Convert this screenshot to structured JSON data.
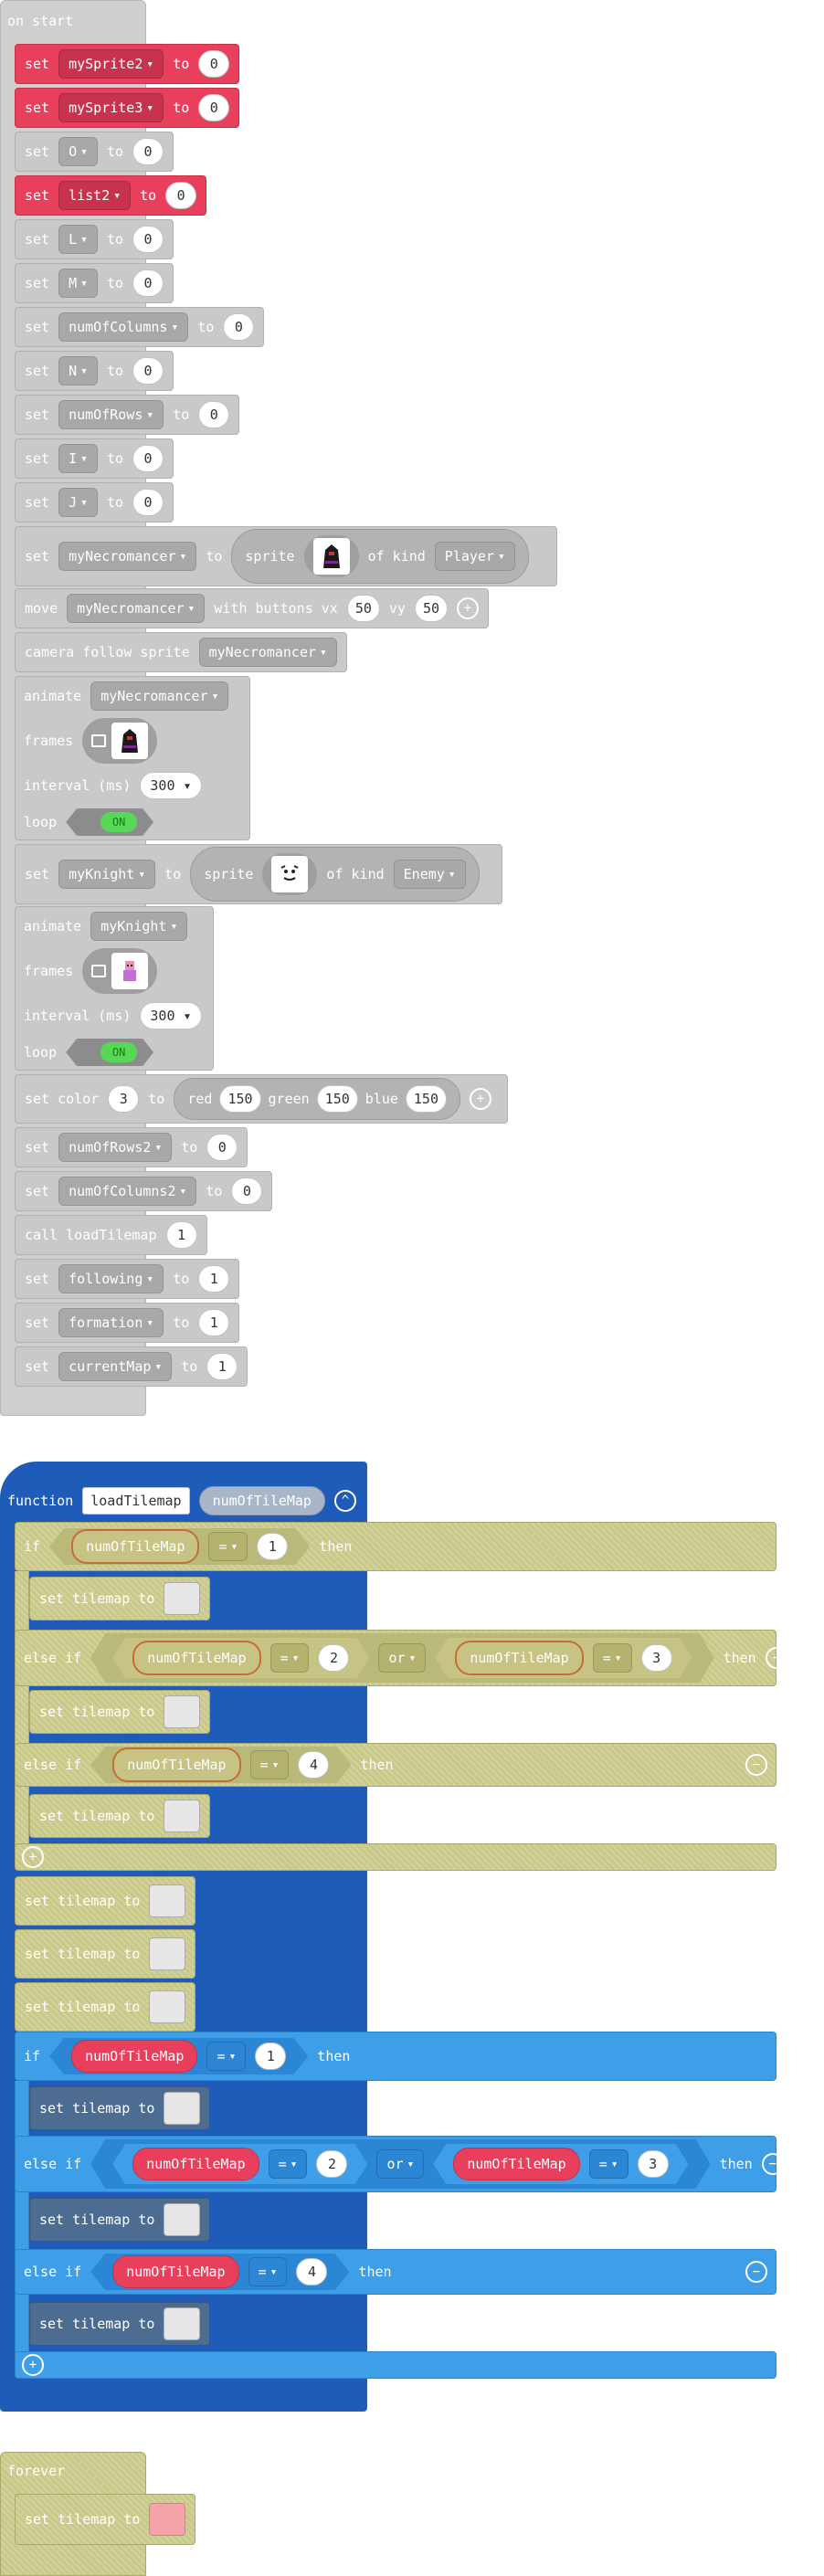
{
  "colors": {
    "gray": "#cfcfcf",
    "red": "#e8405c",
    "olive": "#c8c888",
    "blue": "#3e9fe8",
    "dark_blue": "#1f5bb8",
    "slate": "#4c6c91"
  },
  "on_start": {
    "title": "on start",
    "set_kw": "set",
    "to_kw": "to",
    "sets_a": [
      {
        "var": "mySprite2",
        "val": "0"
      },
      {
        "var": "mySprite3",
        "val": "0"
      },
      {
        "var": "O",
        "val": "0"
      },
      {
        "var": "list2",
        "val": "0"
      },
      {
        "var": "L",
        "val": "0"
      },
      {
        "var": "M",
        "val": "0"
      },
      {
        "var": "numOfColumns",
        "val": "0"
      },
      {
        "var": "N",
        "val": "0"
      },
      {
        "var": "numOfRows",
        "val": "0"
      },
      {
        "var": "I",
        "val": "0"
      },
      {
        "var": "J",
        "val": "0"
      }
    ],
    "necromancer": {
      "var": "myNecromancer",
      "sprite_kw": "sprite",
      "of_kind_kw": "of kind",
      "kind": "Player"
    },
    "move": {
      "kw": "move",
      "var": "myNecromancer",
      "with_kw": "with buttons vx",
      "vx": "50",
      "vy_kw": "vy",
      "vy": "50"
    },
    "camera": {
      "kw": "camera follow sprite",
      "var": "myNecromancer"
    },
    "animate1": {
      "kw": "animate",
      "var": "myNecromancer",
      "frames_kw": "frames",
      "interval_kw": "interval (ms)",
      "interval": "300",
      "loop_kw": "loop",
      "loop_val": "ON"
    },
    "knight": {
      "var": "myKnight",
      "sprite_kw": "sprite",
      "of_kind_kw": "of kind",
      "kind": "Enemy"
    },
    "animate2": {
      "kw": "animate",
      "var": "myKnight",
      "frames_kw": "frames",
      "interval_kw": "interval (ms)",
      "interval": "300",
      "loop_kw": "loop",
      "loop_val": "ON"
    },
    "color": {
      "kw": "set color",
      "index": "3",
      "to_kw": "to",
      "red_kw": "red",
      "red": "150",
      "green_kw": "green",
      "green": "150",
      "blue_kw": "blue",
      "blue": "150"
    },
    "sets_b": [
      {
        "var": "numOfRows2",
        "val": "0"
      },
      {
        "var": "numOfColumns2",
        "val": "0"
      }
    ],
    "call": {
      "kw": "call loadTilemap",
      "val": "1"
    },
    "sets_c": [
      {
        "var": "following",
        "val": "1"
      },
      {
        "var": "formation",
        "val": "1"
      },
      {
        "var": "currentMap",
        "val": "1"
      }
    ]
  },
  "function": {
    "kw": "function",
    "name": "loadTilemap",
    "param": "numOfTileMap",
    "if_kw": "if",
    "else_if_kw": "else if",
    "then_kw": "then",
    "or_kw": "or",
    "eq_op": "=",
    "set_tilemap": "set tilemap to",
    "v1": "1",
    "v2": "2",
    "v3": "3",
    "v4": "4"
  },
  "forever": {
    "title": "forever",
    "set_tilemap": "set tilemap to"
  }
}
